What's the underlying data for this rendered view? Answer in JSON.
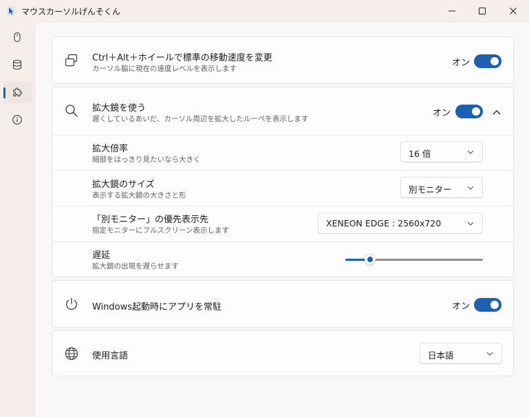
{
  "window": {
    "title": "マウスカーソルげんそくん",
    "icon": "cursor-app-icon",
    "controls": [
      "minimize-icon",
      "maximize-icon",
      "close-icon"
    ]
  },
  "nav": {
    "items": [
      {
        "icon": "mouse-icon",
        "active": false
      },
      {
        "icon": "database-icon",
        "active": false
      },
      {
        "icon": "puzzle-icon",
        "active": true
      },
      {
        "icon": "info-icon",
        "active": false
      }
    ]
  },
  "settings": {
    "speed": {
      "title": "Ctrl＋Alt＋ホイールで標準の移動速度を変更",
      "desc": "カーソル脇に現在の速度レベルを表示します",
      "state_label": "オン",
      "enabled": true,
      "icon": "windows-stack-icon"
    },
    "magnifier": {
      "title": "拡大鏡を使う",
      "desc": "遅くしているあいだ、カーソル周辺を拡大したルーペを表示します",
      "state_label": "オン",
      "enabled": true,
      "expanded": true,
      "icon": "search-icon",
      "zoom": {
        "title": "拡大倍率",
        "desc": "細部をはっきり見たいなら大きく",
        "value": "16 倍"
      },
      "size": {
        "title": "拡大鏡のサイズ",
        "desc": "表示する拡大鏡の大きさと形",
        "value": "別モニター"
      },
      "monitor": {
        "title": "「別モニター」の優先表示先",
        "desc": "指定モニターにフルスクリーン表示します",
        "value": "XENEON EDGE : 2560x720"
      },
      "delay": {
        "title": "遅延",
        "desc": "拡大鏡の出現を遅らせます",
        "level": 0.18
      }
    },
    "startup": {
      "title": "Windows起動時にアプリを常駐",
      "state_label": "オン",
      "enabled": true,
      "icon": "power-icon"
    },
    "language": {
      "title": "使用言語",
      "value": "日本語",
      "icon": "globe-icon"
    }
  },
  "colors": {
    "accent": "#1d5fb3",
    "background": "#f6eeea",
    "card": "#fefdfd"
  }
}
